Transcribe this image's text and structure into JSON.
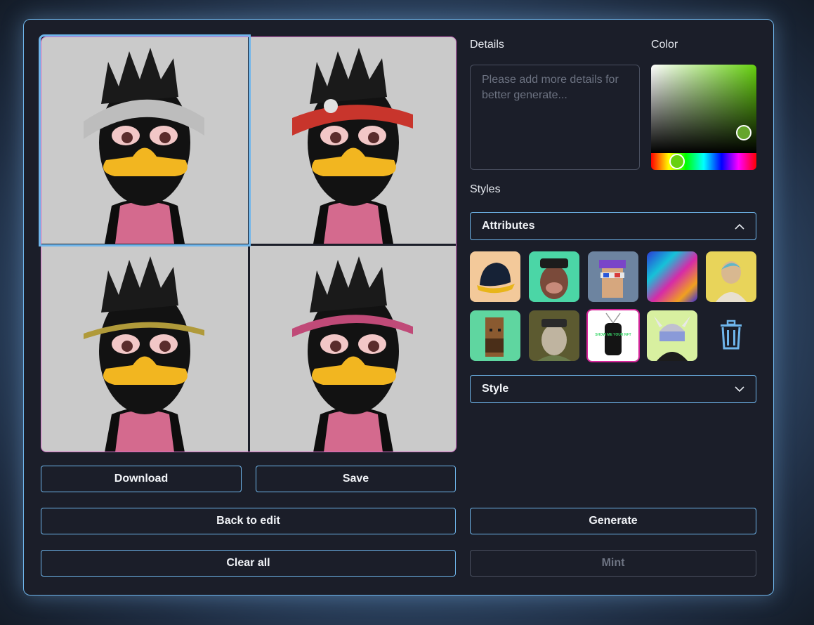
{
  "images": [
    {
      "name": "headband-silver"
    },
    {
      "name": "headband-red-bolts"
    },
    {
      "name": "headband-gold-chain"
    },
    {
      "name": "headband-pink"
    }
  ],
  "buttons": {
    "download": "Download",
    "save": "Save",
    "back_to_edit": "Back to edit",
    "clear_all": "Clear all",
    "generate": "Generate",
    "mint": "Mint"
  },
  "details": {
    "label": "Details",
    "placeholder": "Please add more details for better generate..."
  },
  "color": {
    "label": "Color",
    "selected_hue_hex": "#66d10f"
  },
  "styles": {
    "label": "Styles",
    "attributes_label": "Attributes",
    "style_label": "Style"
  },
  "attributes": [
    {
      "name": "cap"
    },
    {
      "name": "pirate-ape"
    },
    {
      "name": "pixel-punk-purple-cap"
    },
    {
      "name": "psychedelic-fur"
    },
    {
      "name": "blonde-character"
    },
    {
      "name": "pixel-punk-bearded"
    },
    {
      "name": "army-ape"
    },
    {
      "name": "nft-dog-tag",
      "tag_text": "SHOW ME YOUR NFT",
      "selected": true
    },
    {
      "name": "viking-bandana"
    }
  ]
}
